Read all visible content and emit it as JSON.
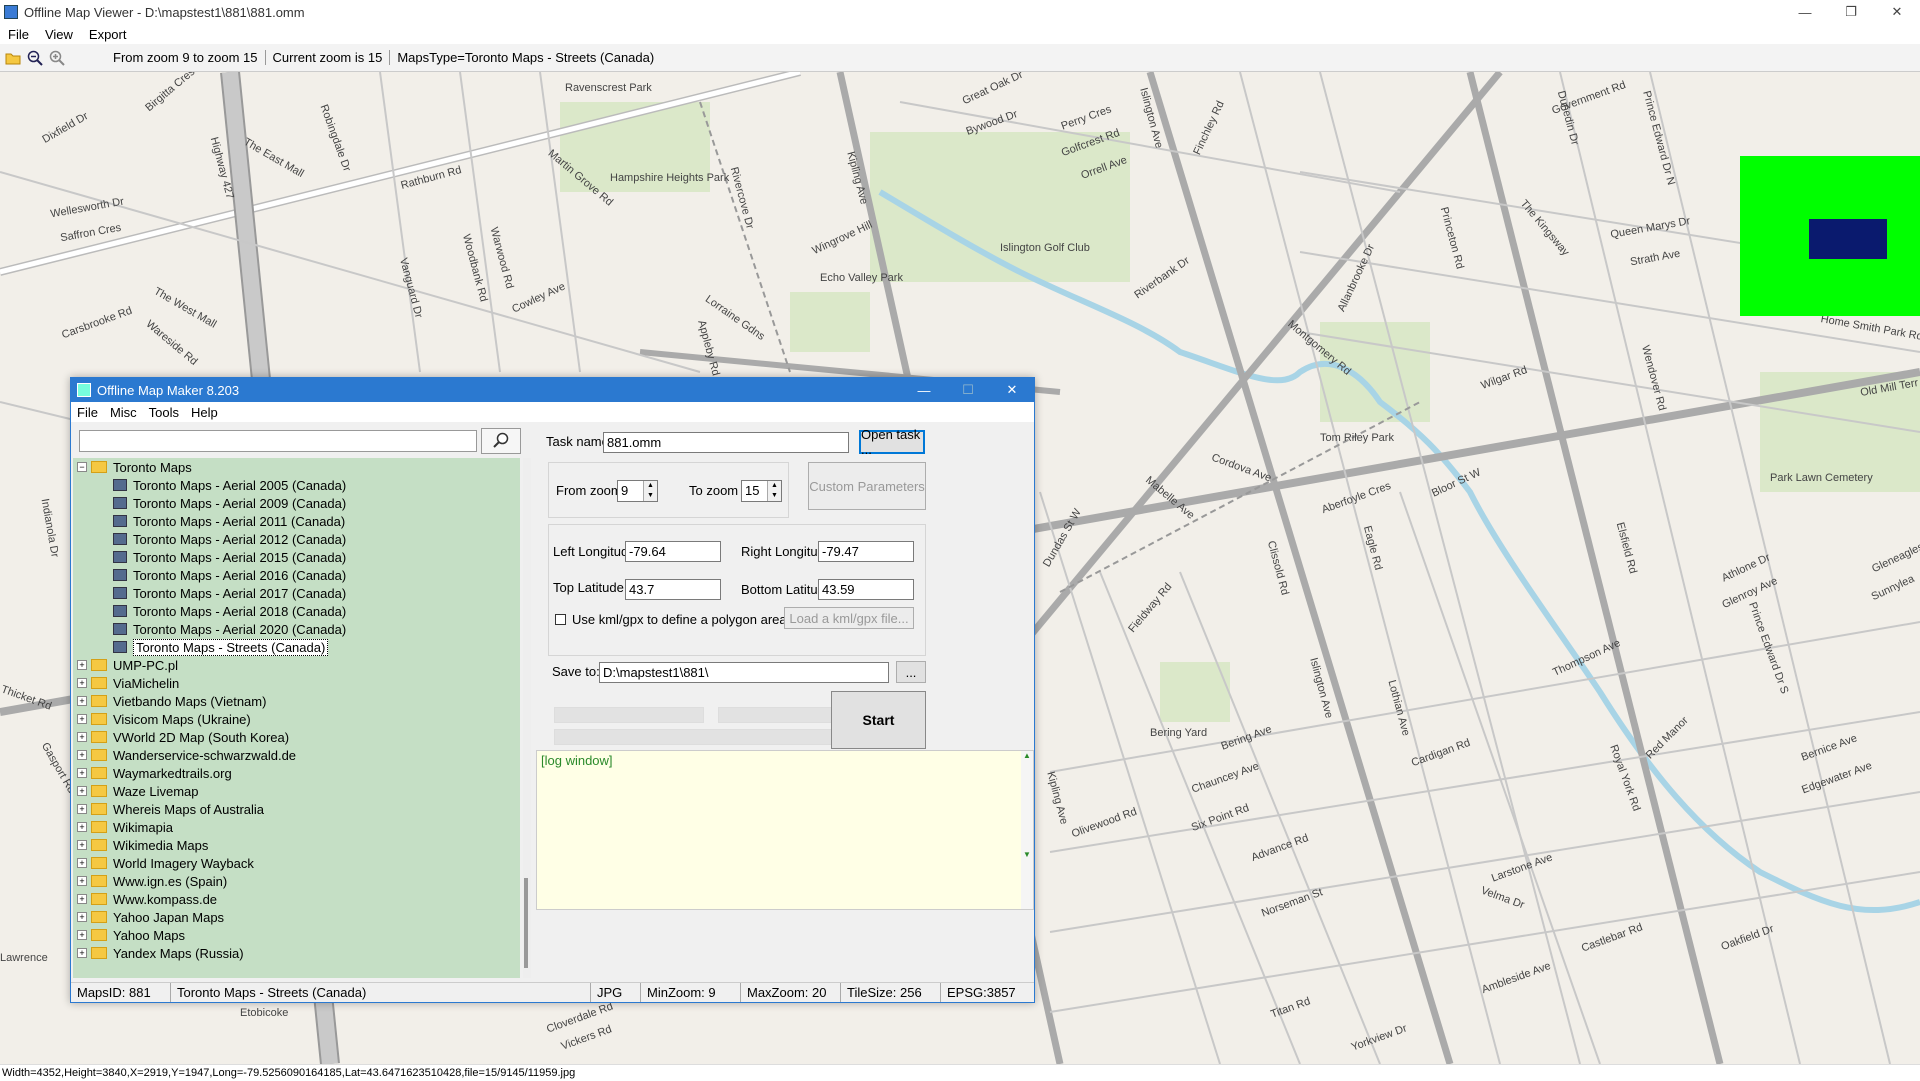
{
  "window": {
    "title": "Offline Map Viewer - D:\\mapstest1\\881\\881.omm",
    "controls": [
      "—",
      "❐",
      "✕"
    ]
  },
  "menu": [
    "File",
    "View",
    "Export"
  ],
  "toolbar": {
    "info": [
      "From zoom 9 to zoom 15",
      "Current zoom is 15",
      "MapsType=Toronto Maps - Streets (Canada)"
    ]
  },
  "map": {
    "labels": [
      "Birgitta Cres",
      "Rathburn Rd",
      "The East Mall",
      "Dixfield Dr",
      "Wellesworth Dr",
      "Saffron Cres",
      "Carsbrooke Rd",
      "The West Mall",
      "Wareside Rd",
      "Highway 427",
      "Robingdale Dr",
      "Ravenscrest Park",
      "Hampshire Heights Park",
      "Martin Grove Rd",
      "Cowley Ave",
      "Vanguard Dr",
      "Woodbank Rd",
      "Warwood Rd",
      "Lorraine Gdns",
      "Appleby Rd",
      "Rivercove Dr",
      "Wingrove Hill",
      "Echo Valley Park",
      "Kipling Ave",
      "Islington Golf Club",
      "Great Oak Dr",
      "Bywood Dr",
      "Perry Cres",
      "Golfcrest Rd",
      "Orrell Ave",
      "Islington Ave",
      "Finchley Rd",
      "Riverbank Dr",
      "Montgomery Rd",
      "Tom Riley Park",
      "Cordova Ave",
      "Mabelle Ave",
      "Dundas St W",
      "Fieldway Rd",
      "Clissold Rd",
      "Islington Ave",
      "Bering Yard",
      "Bering Ave",
      "Chauncey Ave",
      "Six Point Rd",
      "Olivewood Rd",
      "Advance Rd",
      "Norseman St",
      "Kipling Ave",
      "Royal York Rd",
      "Bloor St W",
      "Aberfoyle Cres",
      "Eagle Rd",
      "Lothian Ave",
      "Thompson Ave",
      "Cardigan Rd",
      "Velma Dr",
      "Larstone Ave",
      "Castlebar Rd",
      "Ambleside Ave",
      "Titan Rd",
      "Yorkview Dr",
      "Queen Marys Dr",
      "Strath Ave",
      "The Kingsway",
      "Princeton Rd",
      "Wilgar Rd",
      "Allanbrooke Dr",
      "Park Lawn Cemetery",
      "Athlone Dr",
      "Glenroy Ave",
      "Prince Edward Dr S",
      "Bernice Ave",
      "Edgewater Ave",
      "Oakfield Dr",
      "Red Manor",
      "Home Smith Park Rd",
      "Government Rd",
      "Dunedin Dr",
      "Prince Edward Dr N",
      "Wendover Rd",
      "Elsfield Rd",
      "Gleneagles",
      "Sunnylea",
      "Old Mill Terr",
      "Cloverdale Rd",
      "Vickers Rd",
      "Etobicoke",
      "Gasport Rd",
      "Thicket Rd",
      "Indianola Dr",
      "Lawrence"
    ],
    "overview_bg": "#00ff00",
    "overview_vp": "#0a1a6e"
  },
  "dialog": {
    "title": "Offline Map Maker 8.203",
    "menu": [
      "File",
      "Misc",
      "Tools",
      "Help"
    ],
    "search_value": "",
    "search_icon": "magnifier-icon",
    "tree": {
      "root": "Toronto Maps",
      "children": [
        "Toronto Maps - Aerial 2005 (Canada)",
        "Toronto Maps - Aerial 2009 (Canada)",
        "Toronto Maps - Aerial 2011 (Canada)",
        "Toronto Maps - Aerial 2012 (Canada)",
        "Toronto Maps - Aerial 2015 (Canada)",
        "Toronto Maps - Aerial 2016 (Canada)",
        "Toronto Maps - Aerial 2017 (Canada)",
        "Toronto Maps - Aerial 2018 (Canada)",
        "Toronto Maps - Aerial 2020 (Canada)",
        "Toronto Maps - Streets (Canada)"
      ],
      "folders": [
        "UMP-PC.pl",
        "ViaMichelin",
        "Vietbando Maps (Vietnam)",
        "Visicom Maps (Ukraine)",
        "VWorld 2D Map (South Korea)",
        "Wanderservice-schwarzwald.de",
        "Waymarkedtrails.org",
        "Waze Livemap",
        "Whereis Maps of Australia",
        "Wikimapia",
        "Wikimedia Maps",
        "World Imagery Wayback",
        "Www.ign.es (Spain)",
        "Www.kompass.de",
        "Yahoo Japan Maps",
        "Yahoo Maps",
        "Yandex Maps (Russia)"
      ]
    },
    "task_label": "Task name",
    "task_value": "881.omm",
    "open_task": "Open task ...",
    "from_zoom_label": "From zoom",
    "from_zoom": "9",
    "to_zoom_label": "To zoom",
    "to_zoom": "15",
    "custom_params": "Custom Parameters",
    "left_lon_label": "Left Longitude",
    "left_lon": "-79.64",
    "right_lon_label": "Right Longitude",
    "right_lon": "-79.47",
    "top_lat_label": "Top Latitude",
    "top_lat": "43.7",
    "bottom_lat_label": "Bottom Latitude",
    "bottom_lat": "43.59",
    "kml_label": "Use kml/gpx to define a polygon area",
    "kml_button": "Load a kml/gpx file...",
    "save_label": "Save to:",
    "save_value": "D:\\mapstest1\\881\\",
    "browse": "...",
    "start": "Start",
    "log": "[log window]",
    "status": [
      "MapsID: 881",
      "Toronto Maps - Streets (Canada)",
      "JPG",
      "MinZoom: 9",
      "MaxZoom: 20",
      "TileSize: 256",
      "EPSG:3857"
    ]
  },
  "statusbar": "Width=4352,Height=3840,X=2919,Y=1947,Long=-79.5256090164185,Lat=43.6471623510428,file=15/9145/11959.jpg"
}
